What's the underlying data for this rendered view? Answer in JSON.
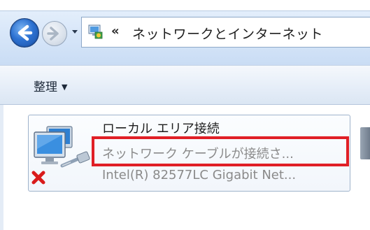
{
  "window": {
    "address_chevron": "«",
    "address_path": "ネットワークとインターネット"
  },
  "toolbar": {
    "organize_label": "整理",
    "organize_arrow": "▼"
  },
  "connection": {
    "name": "ローカル エリア接続",
    "status": "ネットワーク ケーブルが接続さ...",
    "device": "Intel(R) 82577LC Gigabit Net..."
  },
  "icons": {
    "back": "back-arrow-icon",
    "forward": "forward-arrow-icon",
    "address": "network-folder-icon",
    "connection": "network-adapter-icon",
    "disconnected": "red-x-icon"
  },
  "colors": {
    "highlight": "#e01f26",
    "nav_bg": "#d4e4f8",
    "muted_text": "#8a8a8a"
  }
}
